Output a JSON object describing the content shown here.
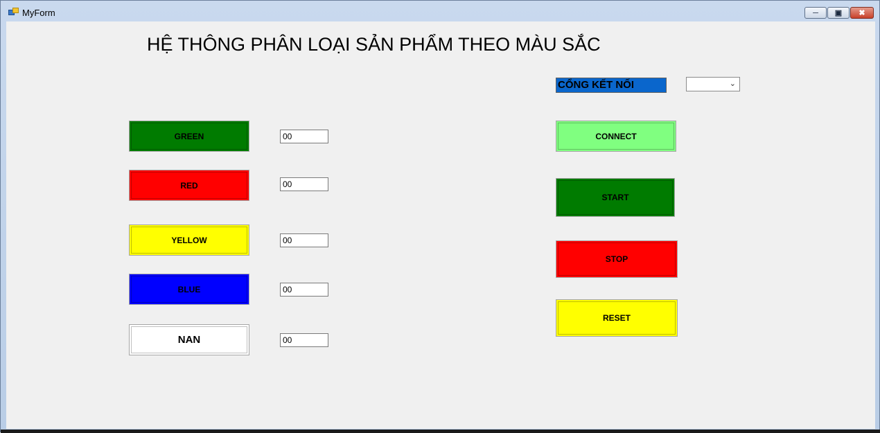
{
  "window": {
    "title": "MyForm"
  },
  "heading": "HỆ THÔNG PHÂN LOẠI SẢN PHẨM THEO MÀU SẮC",
  "colors": [
    {
      "label": "GREEN",
      "count": "00",
      "bg": "#007b00"
    },
    {
      "label": "RED",
      "count": "00",
      "bg": "#ff0000"
    },
    {
      "label": "YELLOW",
      "count": "00",
      "bg": "#ffff00"
    },
    {
      "label": "BLUE",
      "count": "00",
      "bg": "#0000ff"
    },
    {
      "label": "NAN",
      "count": "00",
      "bg": "#ffffff"
    }
  ],
  "port": {
    "label": "CỔNG KẾT NỐI",
    "selected": ""
  },
  "controls": {
    "connect": {
      "label": "CONNECT",
      "bg": "#80ff80"
    },
    "start": {
      "label": "START",
      "bg": "#007b00"
    },
    "stop": {
      "label": "STOP",
      "bg": "#ff0000"
    },
    "reset": {
      "label": "RESET",
      "bg": "#ffff00"
    }
  },
  "icons": {
    "app": "app-form-icon",
    "minimize": "minimize-icon",
    "maximize": "maximize-icon",
    "close": "close-icon",
    "dropdown": "chevron-down-icon"
  }
}
